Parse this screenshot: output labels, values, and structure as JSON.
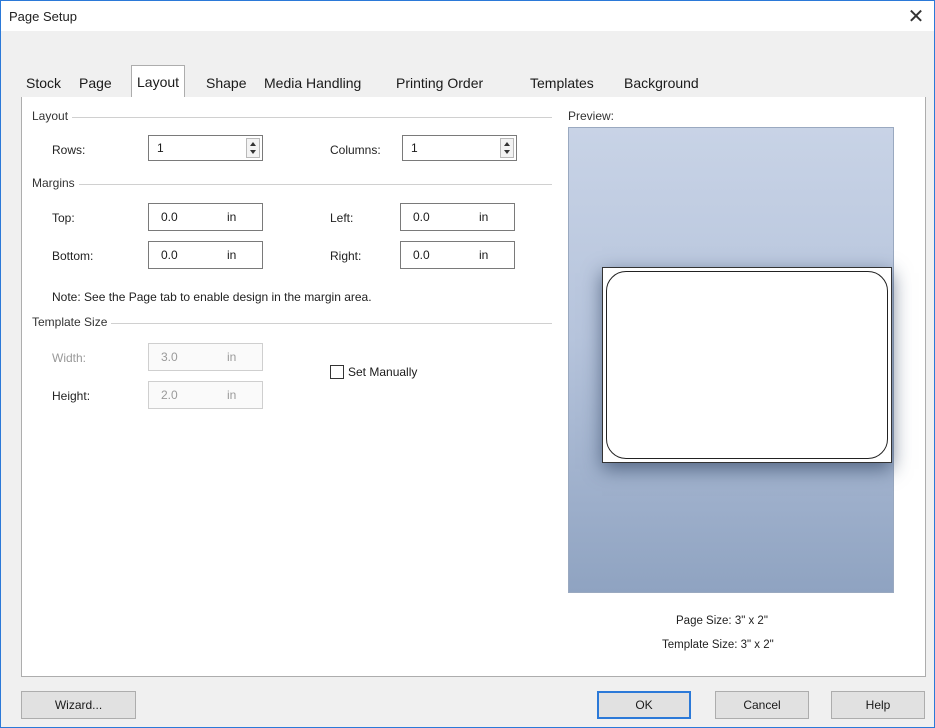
{
  "window": {
    "title": "Page Setup",
    "close": "✕"
  },
  "tabs": [
    {
      "label": "Stock"
    },
    {
      "label": "Page"
    },
    {
      "label": "Layout"
    },
    {
      "label": "Shape"
    },
    {
      "label": "Media Handling"
    },
    {
      "label": "Printing Order"
    },
    {
      "label": "Templates"
    },
    {
      "label": "Background"
    }
  ],
  "active_tab": "Layout",
  "layout_group": {
    "title": "Layout",
    "rows_label": "Rows:",
    "rows_value": "1",
    "columns_label": "Columns:",
    "columns_value": "1"
  },
  "margins_group": {
    "title": "Margins",
    "top_label": "Top:",
    "top_value": "0.0",
    "top_unit": "in",
    "left_label": "Left:",
    "left_value": "0.0",
    "left_unit": "in",
    "bottom_label": "Bottom:",
    "bottom_value": "0.0",
    "bottom_unit": "in",
    "right_label": "Right:",
    "right_value": "0.0",
    "right_unit": "in",
    "note": "Note: See the Page tab to enable design in the margin area."
  },
  "template_size_group": {
    "title": "Template Size",
    "width_label": "Width:",
    "width_value": "3.0",
    "width_unit": "in",
    "height_label": "Height:",
    "height_value": "2.0",
    "height_unit": "in",
    "set_manually_label": "Set Manually",
    "set_manually_checked": false
  },
  "preview": {
    "label": "Preview:",
    "page_size": "Page Size:  3\" x 2\"",
    "template_size": "Template Size:  3\" x 2\""
  },
  "buttons": {
    "wizard": "Wizard...",
    "ok": "OK",
    "cancel": "Cancel",
    "help": "Help"
  },
  "colors": {
    "accent": "#2b79d8",
    "preview_top": "#c8d3e6",
    "preview_bottom": "#8fa3c1"
  }
}
